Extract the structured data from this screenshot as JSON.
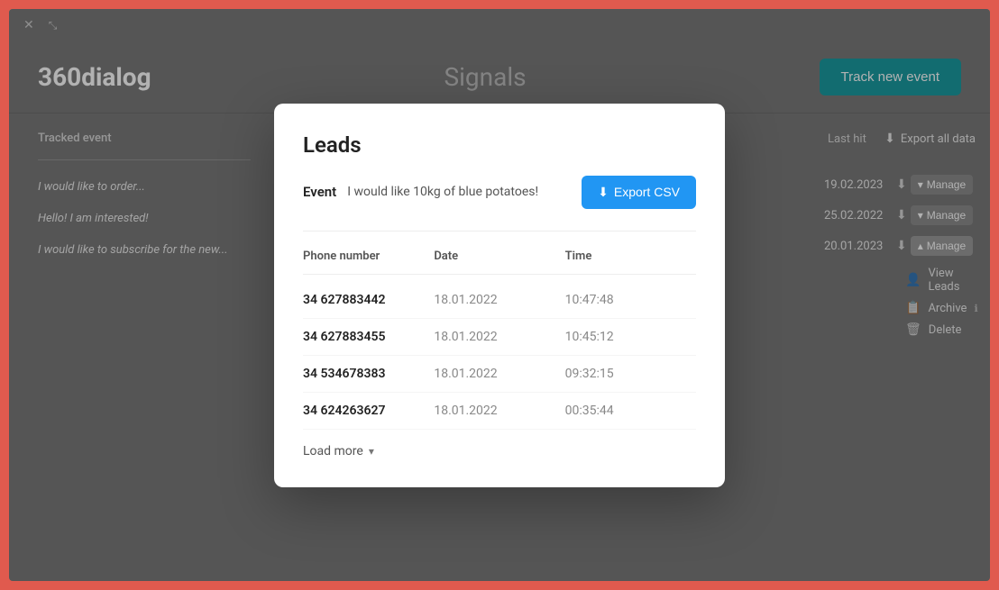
{
  "app": {
    "logo": "360dialog",
    "page_title": "Signals",
    "track_btn_label": "Track new event"
  },
  "topbar": {
    "close_icon": "✕",
    "collapse_icon": "⤡"
  },
  "sidebar": {
    "header": "Tracked event",
    "items": [
      {
        "label": "I would like to order..."
      },
      {
        "label": "Hello! I am interested!"
      },
      {
        "label": "I would like to subscribe for the new..."
      }
    ]
  },
  "right_panel": {
    "last_hit_label": "Last hit",
    "export_label": "Export all data",
    "events": [
      {
        "date": "19.02.2023",
        "manage_label": "Manage",
        "manage_arrow": "▾"
      },
      {
        "date": "25.02.2022",
        "manage_label": "Manage",
        "manage_arrow": "▾"
      },
      {
        "date": "20.01.2023",
        "manage_label": "Manage",
        "manage_arrow": "▴"
      }
    ],
    "actions": [
      {
        "label": "View Leads",
        "icon": "👤"
      },
      {
        "label": "Archive",
        "icon": "📋"
      },
      {
        "label": "Delete",
        "icon": "🗑"
      }
    ]
  },
  "modal": {
    "title": "Leads",
    "event_label": "Event",
    "event_value": "I would like 10kg of blue potatoes!",
    "export_csv_label": "Export CSV",
    "table": {
      "headers": [
        "Phone number",
        "Date",
        "Time"
      ],
      "rows": [
        {
          "phone": "34 627883442",
          "date": "18.01.2022",
          "time": "10:47:48"
        },
        {
          "phone": "34 627883455",
          "date": "18.01.2022",
          "time": "10:45:12"
        },
        {
          "phone": "34 534678383",
          "date": "18.01.2022",
          "time": "09:32:15"
        },
        {
          "phone": "34 624263627",
          "date": "18.01.2022",
          "time": "00:35:44"
        }
      ]
    },
    "load_more_label": "Load more"
  }
}
